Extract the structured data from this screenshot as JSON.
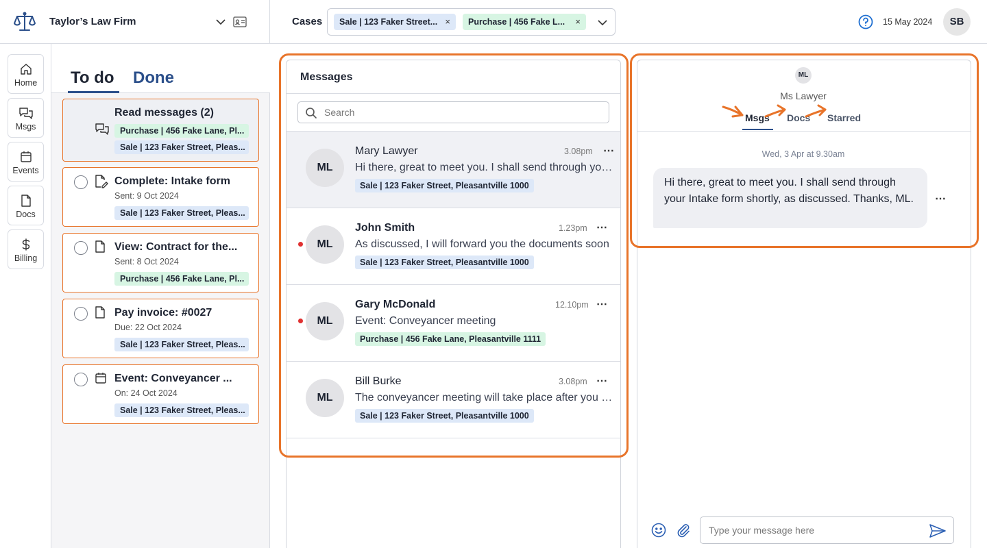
{
  "firm": {
    "name": "Taylor’s Law Firm"
  },
  "topbar": {
    "cases_label": "Cases",
    "case_chips": [
      {
        "label": "Sale | 123 Faker Street...",
        "color": "#dde8f8"
      },
      {
        "label": "Purchase | 456 Fake L...",
        "color": "#d7f5e3"
      }
    ],
    "chip_close": "×",
    "date": "15 May 2024",
    "user_initials": "SB"
  },
  "nav": {
    "items": [
      {
        "label": "Home",
        "icon": "home-icon"
      },
      {
        "label": "Msgs",
        "icon": "chat-icon"
      },
      {
        "label": "Events",
        "icon": "calendar-icon"
      },
      {
        "label": "Docs",
        "icon": "document-icon"
      },
      {
        "label": "Billing",
        "icon": "dollar-icon"
      }
    ]
  },
  "todo": {
    "tab_todo": "To do",
    "tab_done": "Done",
    "tasks": [
      {
        "title": "Read messages (2)",
        "sub": "",
        "icon": "chat-icon",
        "chips": [
          "Purchase | 456 Fake Lane, Pl...",
          "Sale | 123 Faker Street, Pleas..."
        ]
      },
      {
        "title": "Complete: Intake form",
        "sub": "Sent: 9 Oct 2024",
        "icon": "edit-document-icon",
        "chips": [
          "Sale | 123 Faker Street, Pleas..."
        ]
      },
      {
        "title": "View: Contract for the...",
        "sub": "Sent: 8 Oct 2024",
        "icon": "document-icon",
        "chips": [
          "Purchase | 456 Fake Lane, Pl..."
        ]
      },
      {
        "title": "Pay invoice: #0027",
        "sub": "Due: 22 Oct 2024",
        "icon": "document-icon",
        "chips": [
          "Sale | 123 Faker Street, Pleas..."
        ]
      },
      {
        "title": "Event: Conveyancer ...",
        "sub": "On: 24 Oct 2024",
        "icon": "calendar-icon",
        "chips": [
          "Sale | 123 Faker Street, Pleas..."
        ]
      }
    ]
  },
  "messages": {
    "title": "Messages",
    "search_placeholder": "Search",
    "items": [
      {
        "initials": "ML",
        "name": "Mary Lawyer",
        "time": "3.08pm",
        "preview": "Hi there, great to meet you. I shall send through your Intake form shortly",
        "chip": "Sale | 123 Faker Street, Pleasantville 1000",
        "unread": false,
        "more": "⋯"
      },
      {
        "initials": "ML",
        "name": "John Smith",
        "time": "1.23pm",
        "preview": "As discussed, I will forward you the documents soon",
        "chip": "Sale | 123 Faker Street, Pleasantville 1000",
        "unread": true,
        "more": "⋯"
      },
      {
        "initials": "ML",
        "name": "Gary McDonald",
        "time": "12.10pm",
        "preview": "Event: Conveyancer meeting",
        "chip": "Purchase | 456 Fake Lane, Pleasantville 1111",
        "unread": true,
        "more": "⋯"
      },
      {
        "initials": "ML",
        "name": "Bill Burke",
        "time": "3.08pm",
        "preview": "The conveyancer meeting will take place after you sign",
        "chip": "Sale | 123 Faker Street, Pleasantville 1000",
        "unread": false,
        "more": "⋯"
      }
    ]
  },
  "conversation": {
    "initials": "ML",
    "name": "Ms Lawyer",
    "tabs": [
      "Msgs",
      "Docs",
      "Starred"
    ],
    "date": "Wed, 3 Apr at 9.30am",
    "bubble": "Hi there, great to meet you. I shall send through your Intake form shortly, as discussed. Thanks, ML.",
    "bubble_more": "⋯",
    "compose_placeholder": "Type your message here"
  },
  "colors": {
    "highlight": "#e8742a",
    "accent": "#2b4f8a",
    "unread": "#e03131",
    "chip_blue": "#dde8f8",
    "chip_green": "#d7f5e3"
  }
}
